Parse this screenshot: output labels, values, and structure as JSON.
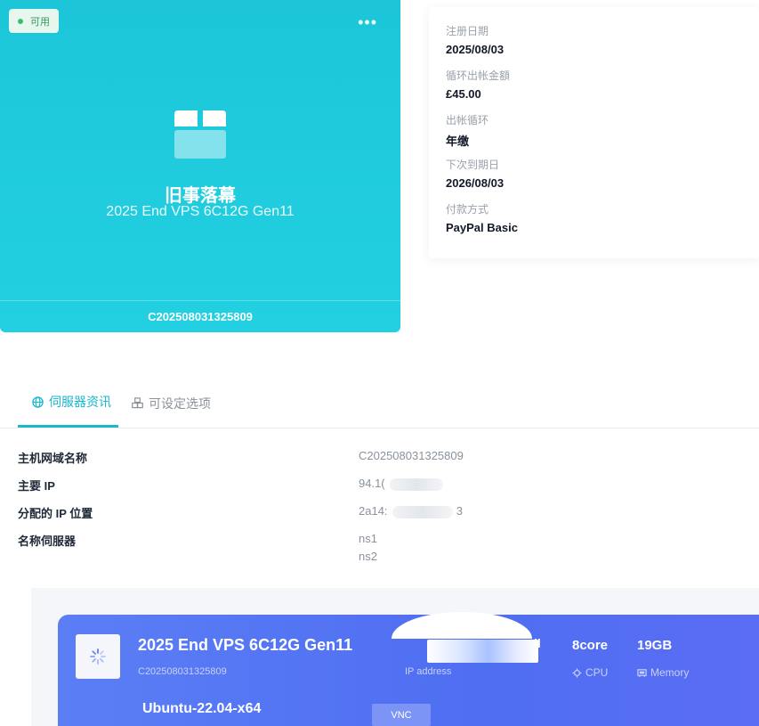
{
  "product": {
    "status": "可用",
    "name": "旧事落幕",
    "plan": "2025 End VPS 6C12G Gen11",
    "domain": "C202508031325809",
    "more_label": "•••"
  },
  "billing": {
    "items": [
      {
        "label": "注册日期",
        "value": "2025/08/03"
      },
      {
        "label": "循环出帐金額",
        "value": "£45.00"
      },
      {
        "label": "出帐循环",
        "value": "年缴"
      },
      {
        "label": "下次到期日",
        "value": "2026/08/03"
      },
      {
        "label": "付款方式",
        "value": "PayPal Basic"
      }
    ]
  },
  "tabs": [
    {
      "label": "伺服器资讯",
      "icon": "globe-icon",
      "active": true
    },
    {
      "label": "可设定选项",
      "icon": "cubes-icon",
      "active": false
    }
  ],
  "server_info": {
    "hostname_label": "主机网域名称",
    "hostname_value": "C202508031325809",
    "primary_ip_label": "主要 IP",
    "primary_ip_value": "94.1(",
    "assigned_ip_label": "分配的 IP 位置",
    "assigned_ip_value": "2a14:",
    "assigned_ip_tail": "3",
    "nameservers_label": "名称伺服器",
    "ns1": "ns1",
    "ns2": "ns2"
  },
  "vps": {
    "name": "2025 End VPS 6C12G Gen11",
    "domain": "C202508031325809",
    "os": "Ubuntu-22.04-x64",
    "ip_label": "IP address",
    "ip_tail": "il",
    "cpu_value": "8core",
    "cpu_label": "CPU",
    "memory_value": "19GB",
    "memory_label": "Memory",
    "vnc_label": "VNC"
  },
  "colors": {
    "card": "#1ec8da",
    "accent": "#17b6cc",
    "vps_panel": "#5577f4",
    "status_green": "#3dbb6f"
  }
}
